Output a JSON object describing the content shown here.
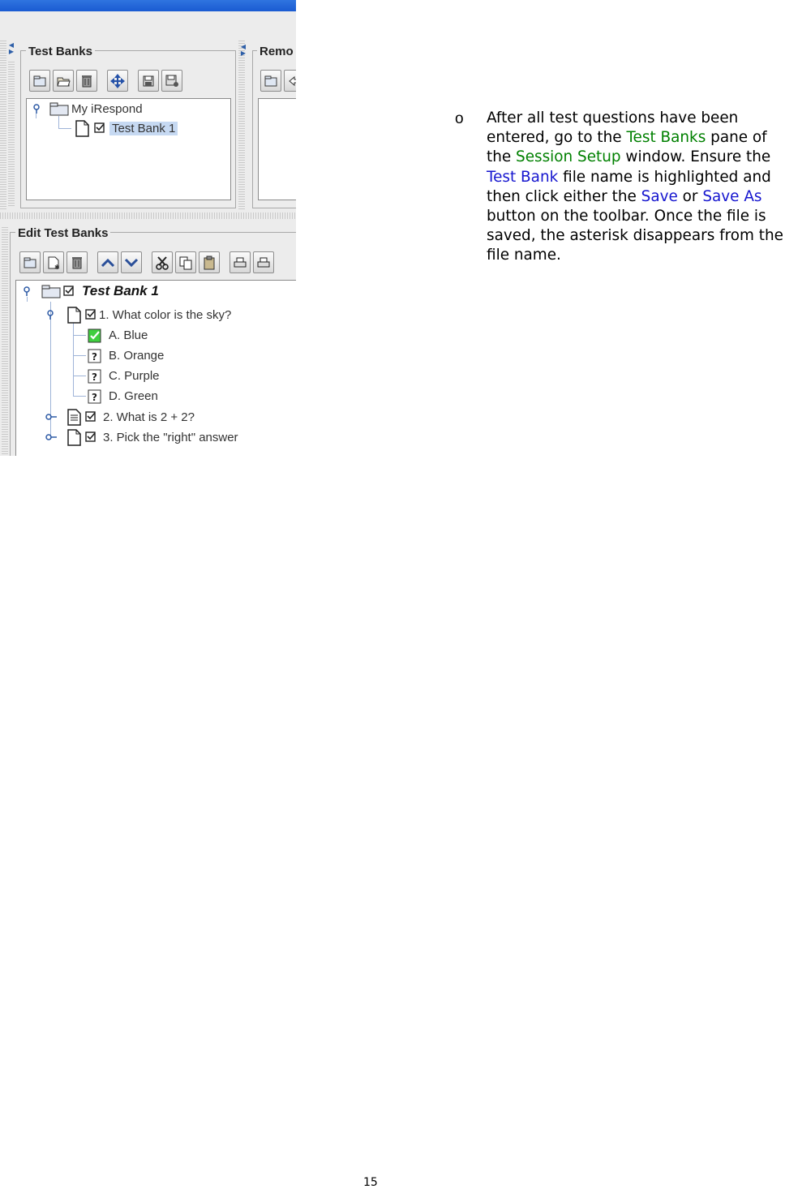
{
  "screenshot": {
    "test_banks_panel": {
      "title": "Test Banks",
      "toolbar": [
        "new-folder-icon",
        "open-folder-icon",
        "trash-icon",
        "move-icon",
        "save-icon",
        "save-as-icon"
      ],
      "tree": {
        "root": "My iRespond",
        "child": "Test Bank 1"
      }
    },
    "remote_panel": {
      "title": "Remo"
    },
    "edit_panel": {
      "title": "Edit Test Banks",
      "tree": {
        "root": "Test Bank 1",
        "questions": [
          {
            "label": "1. What color is the sky?",
            "answers": [
              {
                "label": "A. Blue",
                "correct": true
              },
              {
                "label": "B. Orange",
                "correct": false
              },
              {
                "label": "C. Purple",
                "correct": false
              },
              {
                "label": "D. Green",
                "correct": false
              }
            ]
          },
          {
            "label": "2. What is 2 + 2?"
          },
          {
            "label": "3. Pick the \"right\" answer"
          }
        ]
      }
    }
  },
  "instruction": {
    "bullet": "o",
    "t1": "After all test questions have been entered, go to the ",
    "k1": "Test Banks",
    "t2": " pane of the ",
    "k2": "Session Setup",
    "t3": " window.  Ensure the ",
    "k3": "Test Bank",
    "t4": " file name is highlighted and then click either the ",
    "k4": "Save",
    "t5": " or ",
    "k5": "Save As",
    "t6": " button on the toolbar.  Once the file is saved, the asterisk disappears from the file name."
  },
  "colors": {
    "green_keyword": "#008000",
    "blue_keyword": "#1515cf"
  },
  "page_number": "15"
}
